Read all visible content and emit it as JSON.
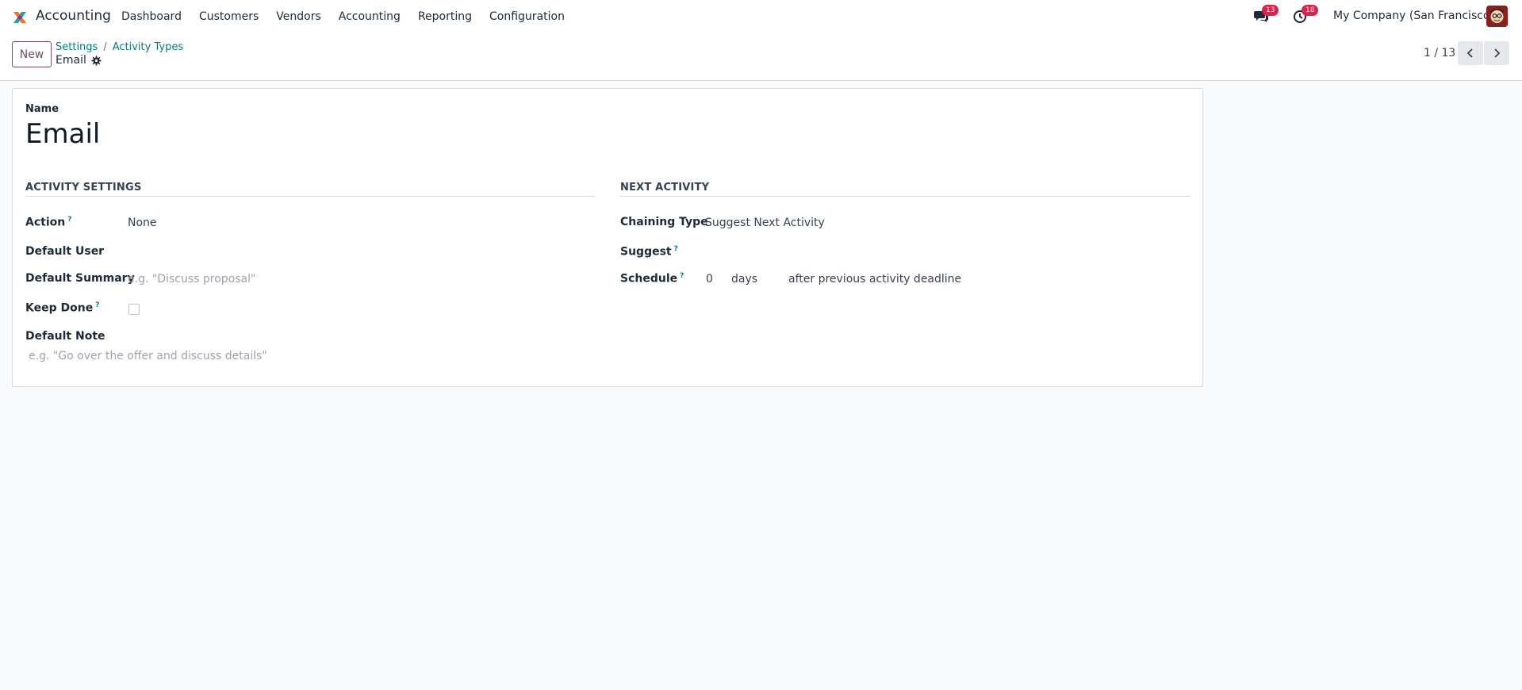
{
  "app": {
    "name": "Accounting"
  },
  "menu": [
    "Dashboard",
    "Customers",
    "Vendors",
    "Accounting",
    "Reporting",
    "Configuration"
  ],
  "systray": {
    "messages_count": "13",
    "activities_count": "18",
    "company": "My Company (San Francisco)"
  },
  "control": {
    "new_label": "New",
    "breadcrumb": [
      "Settings",
      "Activity Types"
    ],
    "breadcrumb_sep": "/",
    "current": "Email",
    "pager": "1 / 13"
  },
  "form": {
    "name_label": "Name",
    "name_value": "Email",
    "activity_settings": {
      "title": "ACTIVITY SETTINGS",
      "action_label": "Action",
      "action_value": "None",
      "default_user_label": "Default User",
      "default_summary_label": "Default Summary",
      "default_summary_placeholder": "e.g. \"Discuss proposal\"",
      "keep_done_label": "Keep Done",
      "keep_done_checked": false,
      "default_note_label": "Default Note",
      "default_note_placeholder": "e.g. \"Go over the offer and discuss details\""
    },
    "next_activity": {
      "title": "NEXT ACTIVITY",
      "chaining_type_label": "Chaining Type",
      "chaining_type_value": "Suggest Next Activity",
      "suggest_label": "Suggest",
      "schedule_label": "Schedule",
      "schedule_value": "0",
      "schedule_unit": "days",
      "schedule_from": "after previous activity deadline"
    },
    "help_marker": "?"
  },
  "colors": {
    "brand": "#714b67",
    "link": "#017e84",
    "badge": "#e11d48"
  }
}
